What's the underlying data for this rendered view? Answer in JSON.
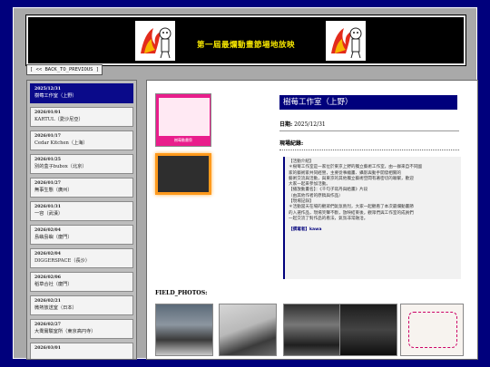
{
  "banner": {
    "title": "第一屆最爛動畫節場地放映"
  },
  "nav": {
    "back_label": "[ << BACK_TO_PREVIOUS ]"
  },
  "sidebar": {
    "items": [
      {
        "date": "2025/12/31",
        "name": "樹莓工作室（上野）",
        "active": true
      },
      {
        "date": "2026/01/01",
        "name": "KARTUL（愛沙尼亞）"
      },
      {
        "date": "2026/01/17",
        "name": "Cedar Kitchen（上海）"
      },
      {
        "date": "2026/01/25",
        "name": "別的盒子bubox（北京）"
      },
      {
        "date": "2026/01/27",
        "name": "無事生態（廣州）"
      },
      {
        "date": "2026/01/31",
        "name": "一容（武漢）"
      },
      {
        "date": "2026/02/04",
        "name": "島嶼島嶼（廈門）"
      },
      {
        "date": "2026/02/04",
        "name": "DIGGERSPACE（長沙）"
      },
      {
        "date": "2026/02/06",
        "name": "稻草合社（廈門）"
      },
      {
        "date": "2026/02/21",
        "name": "微熱放送室（日本）"
      },
      {
        "date": "2026/02/27",
        "name": "大喬實驗室所（東京高円寺）"
      },
      {
        "date": "2026/03/01",
        "name": ""
      }
    ]
  },
  "detail": {
    "poster_label": "樹莓動畫祭",
    "title": "樹莓工作室（上野）",
    "date_label": "日期:",
    "date_value": "2025/12/31",
    "log_heading": "現場紀錄:",
    "log_lines": [
      "【活動介紹】",
      "＊樹莓工作室是一家位於東京上野的獨立藝術工作室，由一群來自不同國",
      "家的藝術家共同經營，主要從事繪畫、攝影與動手開發相關的",
      "藝術交流與活動，與東京的其他獨立藝術空間有著密切的聯繫，歡迎",
      "大家一起來參加活動。",
      "【播放動畫名】：《千句子寫丹與給畫》片段",
      "（由其他作者的原稿與作品）",
      "【現場記錄】",
      "＊活動當天在場的觀眾們氣氛熱烈，大家一起觀看了本次最爛動畫節",
      "的入選作品，現場笑聲不斷，放映結束後，觀眾們與工作室的成員們",
      "一起交流了對作品的看法，氣氛非常融洽。",
      "",
      "【撰寫者】kawa"
    ],
    "photos_heading": "FIELD_PHOTOS:"
  }
}
